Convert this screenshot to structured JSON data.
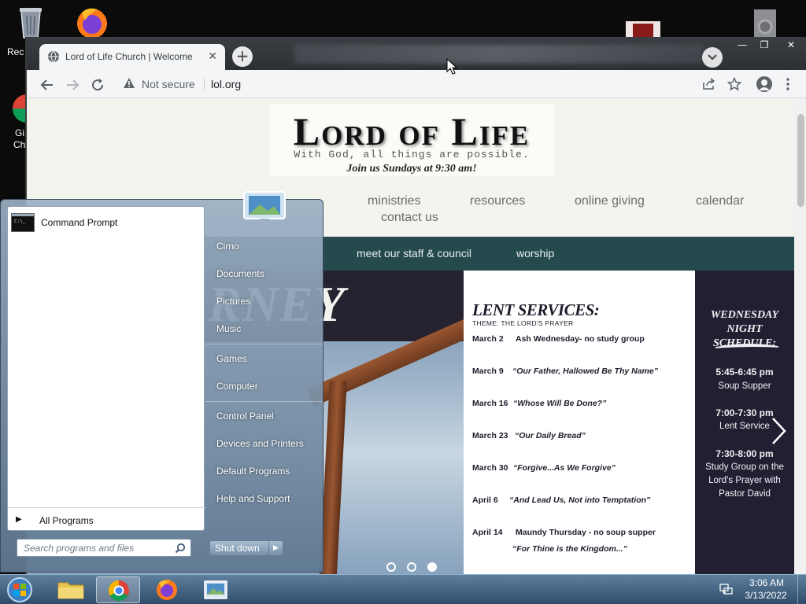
{
  "desktop": {
    "recycle_label": "Rec",
    "chrome_label_1": "Gi",
    "chrome_label_2": "Ch"
  },
  "browser": {
    "tab_title": "Lord of Life Church | Welcome",
    "tab_close": "✕",
    "new_tab": "+",
    "window_controls": [
      "—",
      "❐",
      "✕"
    ],
    "security_text": "Not secure",
    "url": "lol.org"
  },
  "page": {
    "logo": {
      "title": "Lord of Life",
      "tagline": "With God, all things are possible.",
      "join": "Join us Sundays at 9:30 am!"
    },
    "nav": [
      "ministries",
      "resources",
      "online giving",
      "calendar",
      "contact us"
    ],
    "bar_items": [
      "meet our staff & council",
      "worship"
    ],
    "banner_word": "RNEY",
    "lent": {
      "title": "LENT SERVICES:",
      "theme": "THEME: THE LORD'S PRAYER",
      "rows": [
        {
          "date": "March 2",
          "desc": "Ash Wednesday- no study group"
        },
        {
          "date": "March 9",
          "desc": "“Our Father, Hallowed Be Thy Name”"
        },
        {
          "date": "March 16",
          "desc": "“Whose Will Be Done?”"
        },
        {
          "date": "March 23",
          "desc": "“Our Daily Bread”"
        },
        {
          "date": "March 30",
          "desc": "“Forgive...As We Forgive”"
        },
        {
          "date": "April 6",
          "desc": "“And Lead Us, Not into Temptation”"
        },
        {
          "date": "April 14",
          "desc": "Maundy Thursday - no soup supper"
        }
      ],
      "extra": "“For Thine is the Kingdom...”"
    },
    "wednesday": {
      "title_1": "WEDNESDAY NIGHT",
      "title_2": "SCHEDULE:",
      "time_1": "5:45-6:45 pm",
      "desc_1": "Soup Supper",
      "time_2": "7:00-7:30 pm",
      "desc_2": "Lent Service",
      "time_3": "7:30-8:00 pm",
      "desc_3_1": "Study Group on the",
      "desc_3_2": "Lord's Prayer with",
      "desc_3_3": "Pastor David"
    }
  },
  "start_menu": {
    "pinned": "Command Prompt",
    "all_programs": "All Programs",
    "search_placeholder": "Search programs and files",
    "right_items": [
      "Cirno",
      "Documents",
      "Pictures",
      "Music",
      "Games",
      "Computer",
      "Control Panel",
      "Devices and Printers",
      "Default Programs",
      "Help and Support"
    ],
    "shutdown": "Shut down"
  },
  "taskbar": {
    "time": "3:06 AM",
    "date": "3/13/2022"
  }
}
